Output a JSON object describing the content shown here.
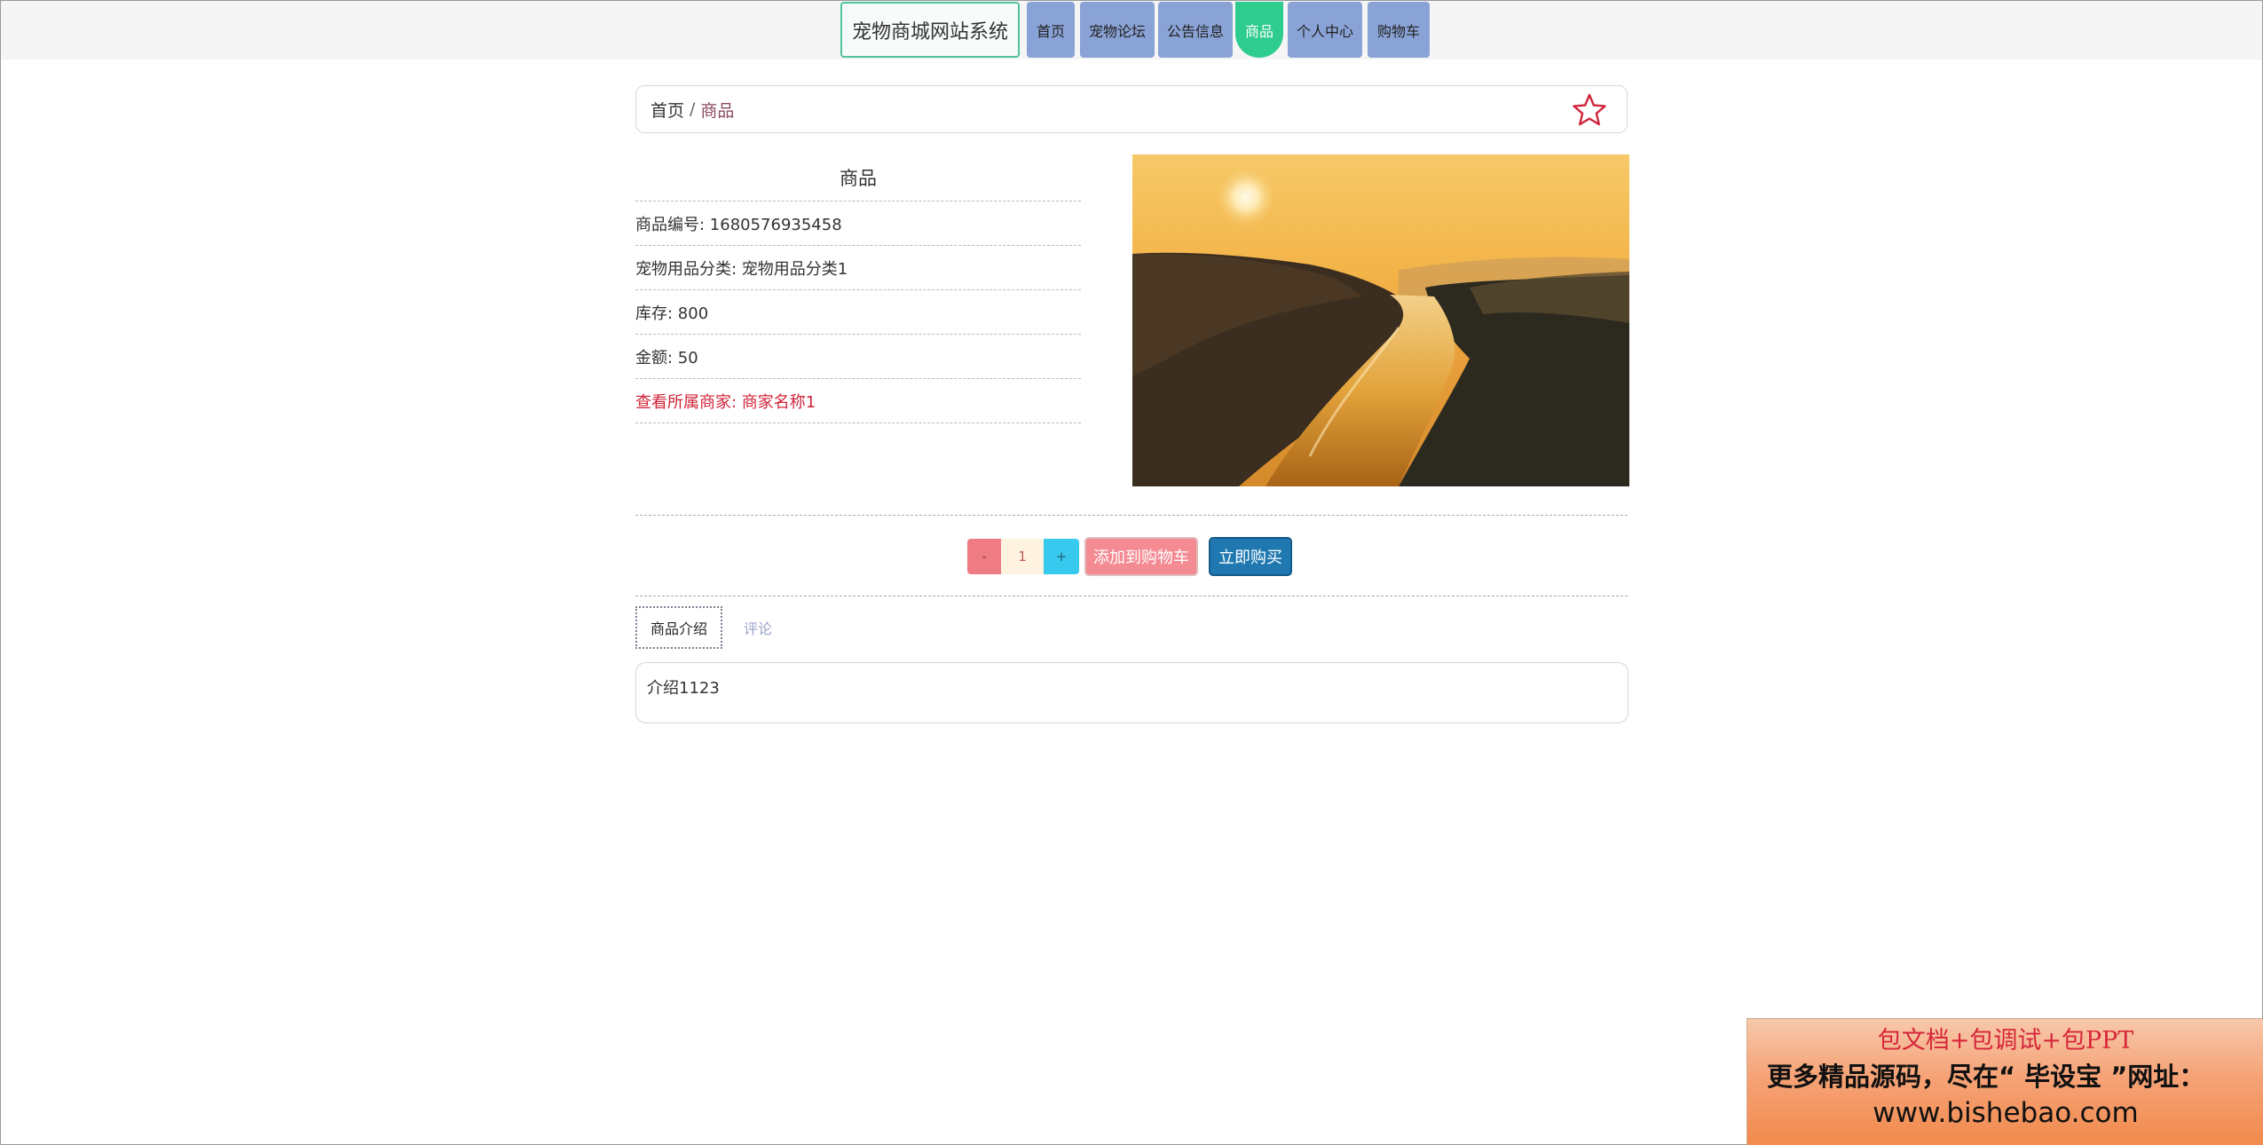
{
  "nav": {
    "brand": "宠物商城网站系统",
    "items": [
      {
        "label": "首页"
      },
      {
        "label": "宠物论坛"
      },
      {
        "label": "公告信息"
      },
      {
        "label": "商品"
      },
      {
        "label": "个人中心"
      },
      {
        "label": "购物车"
      }
    ],
    "active_index": 3
  },
  "breadcrumb": {
    "home": "首页",
    "separator": "/",
    "current": "商品"
  },
  "product": {
    "section_title": "商品",
    "fields": [
      {
        "text": "商品编号: 1680576935458"
      },
      {
        "text": "宠物用品分类: 宠物用品分类1"
      },
      {
        "text": "库存: 800"
      },
      {
        "text": "金额: 50"
      }
    ],
    "merchant_link": "查看所属商家: 商家名称1"
  },
  "purchase": {
    "minus": "-",
    "quantity": "1",
    "plus": "+",
    "add_to_cart": "添加到购物车",
    "buy_now": "立即购买"
  },
  "tabs": {
    "intro": "商品介绍",
    "reviews": "评论",
    "intro_content": "介绍1123"
  },
  "ad": {
    "line1": "包文档+包调试+包PPT",
    "line2": "更多精品源码，尽在“ 毕设宝 ”网址：",
    "line3": "www.bishebao.com"
  },
  "colors": {
    "active_nav": "#2ecc8f",
    "nav": "#8aa3d6",
    "merchant_link": "#d0243a",
    "buy_button": "#1f78b0",
    "cart_button": "#f48a92"
  }
}
